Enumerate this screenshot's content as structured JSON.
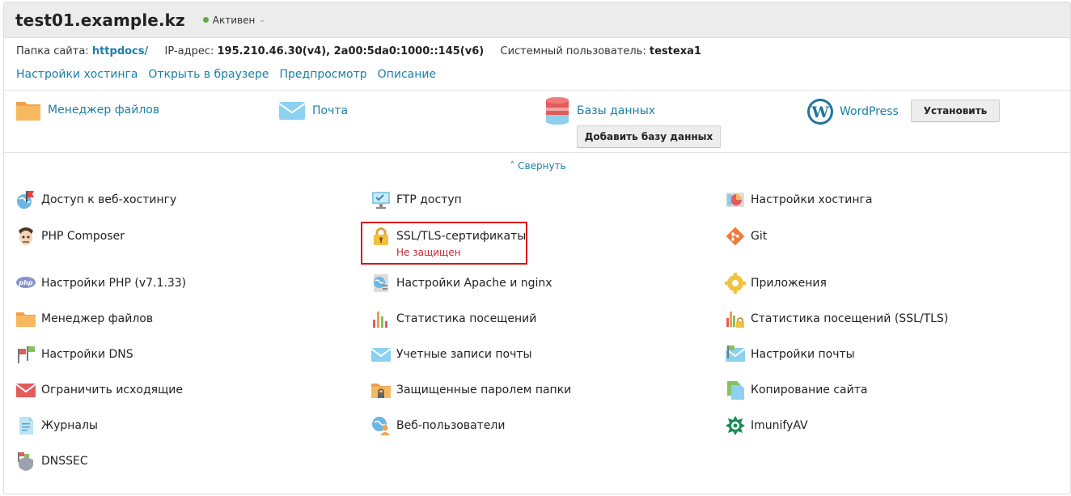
{
  "header": {
    "domain": "test01.example.kz",
    "status": "Активен"
  },
  "info": {
    "folder_label": "Папка сайта:",
    "folder_value": "httpdocs/",
    "ip_label": "IP-адрес:",
    "ip_value": "195.210.46.30(v4), 2a00:5da0:1000::145(v6)",
    "user_label": "Системный пользователь:",
    "user_value": "testexa1"
  },
  "links": [
    "Настройки хостинга",
    "Открыть в браузере",
    "Предпросмотр",
    "Описание"
  ],
  "quick": {
    "file_manager": "Менеджер файлов",
    "mail": "Почта",
    "databases": "Базы данных",
    "add_db_button": "Добавить базу данных",
    "wordpress": "WordPress",
    "install_button": "Установить"
  },
  "collapse": "Свернуть",
  "tools": {
    "web_access": "Доступ к веб-хостингу",
    "ftp": "FTP доступ",
    "hosting_settings": "Настройки хостинга",
    "php_composer": "PHP Composer",
    "ssl": "SSL/TLS-сертификаты",
    "ssl_status": "Не защищен",
    "git": "Git",
    "php_settings": "Настройки PHP (v7.1.33)",
    "apache_nginx": "Настройки Apache и nginx",
    "applications": "Приложения",
    "file_manager": "Менеджер файлов",
    "stats": "Статистика посещений",
    "stats_ssl": "Статистика посещений (SSL/TLS)",
    "dns": "Настройки DNS",
    "mail_accounts": "Учетные записи почты",
    "mail_settings": "Настройки почты",
    "limit_outgoing": "Ограничить исходящие",
    "protected_dirs": "Защищенные паролем папки",
    "site_copy": "Копирование сайта",
    "logs": "Журналы",
    "web_users": "Веб-пользователи",
    "imunify": "ImunifyAV",
    "dnssec": "DNSSEC"
  },
  "colors": {
    "link": "#1b7fa6",
    "status_active": "#5aac3c",
    "alert": "#c8262d",
    "highlight_box": "#d9141c"
  }
}
